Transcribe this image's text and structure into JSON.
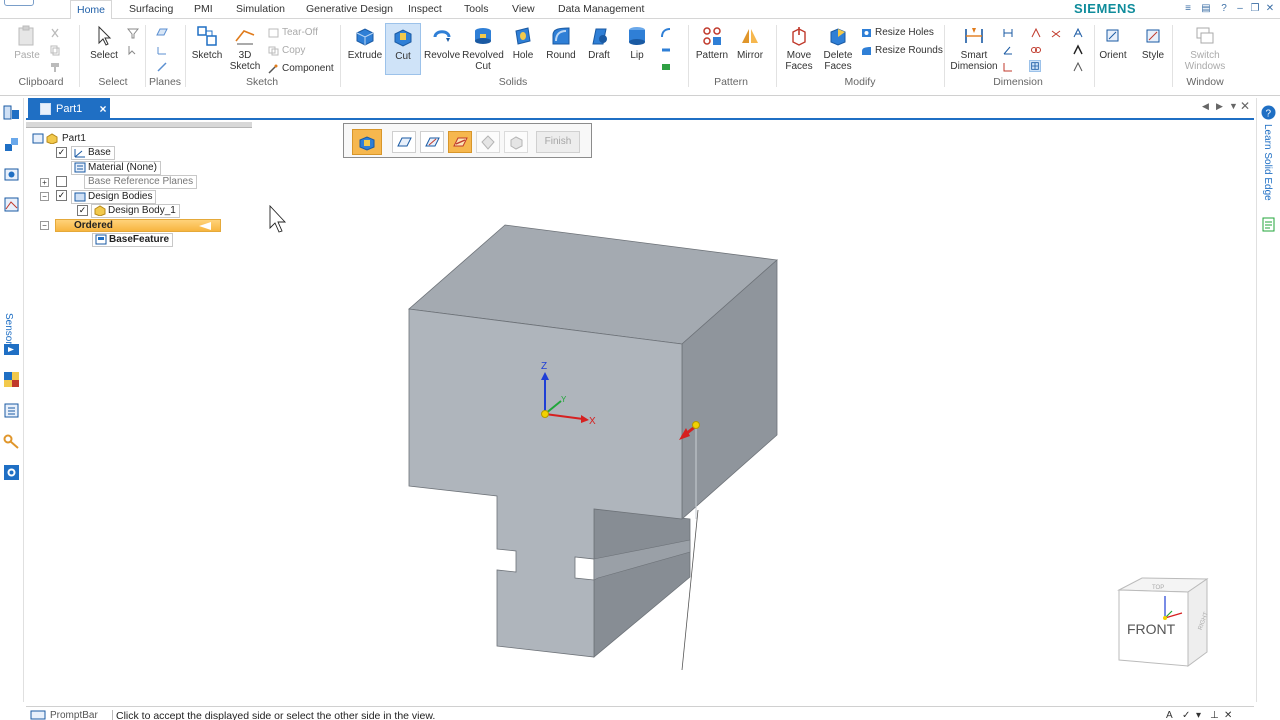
{
  "ribbon": {
    "tabs": [
      "Home",
      "Surfacing",
      "PMI",
      "Simulation",
      "Generative Design",
      "Inspect",
      "Tools",
      "View",
      "Data Management"
    ],
    "active_tab": "Home",
    "brand": "SIEMENS",
    "groups": {
      "clipboard": "Clipboard",
      "select": "Select",
      "planes": "Planes",
      "sketch": "Sketch",
      "solids": "Solids",
      "pattern": "Pattern",
      "modify": "Modify",
      "dimension": "Dimension",
      "window": "Window"
    },
    "buttons": {
      "paste": "Paste",
      "select": "Select",
      "sketch": "Sketch",
      "sketch3d_line1": "3D",
      "sketch3d_line2": "Sketch",
      "tear_off": "Tear-Off",
      "copy": "Copy",
      "component": "Component",
      "extrude": "Extrude",
      "cut": "Cut",
      "revolve": "Revolve",
      "revolved_cut_line1": "Revolved",
      "revolved_cut_line2": "Cut",
      "hole": "Hole",
      "round": "Round",
      "draft": "Draft",
      "lip": "Lip",
      "pattern": "Pattern",
      "mirror": "Mirror",
      "move_faces_line1": "Move",
      "move_faces_line2": "Faces",
      "delete_faces_line1": "Delete",
      "delete_faces_line2": "Faces",
      "resize_holes": "Resize Holes",
      "resize_rounds": "Resize Rounds",
      "smart_dimension_line1": "Smart",
      "smart_dimension_line2": "Dimension",
      "orient": "Orient",
      "style": "Style",
      "switch_windows_line1": "Switch",
      "switch_windows_line2": "Windows"
    }
  },
  "document": {
    "tab_title": "Part1"
  },
  "left_toolbar": {
    "sensors_label": "Sensors"
  },
  "pathfinder": {
    "root": "Part1",
    "base": "Base",
    "material": "Material (None)",
    "base_reference_planes": "Base Reference Planes",
    "design_bodies": "Design Bodies",
    "design_body_1": "Design Body_1",
    "ordered": "Ordered",
    "base_feature": "BaseFeature"
  },
  "command_bar": {
    "finish": "Finish"
  },
  "viewport": {
    "triad": {
      "x": "X",
      "y": "Y",
      "z": "Z"
    },
    "view_cube": {
      "front": "FRONT",
      "top": "TOP",
      "right": "RIGHT"
    }
  },
  "right_panel": {
    "learn": "Learn Solid Edge"
  },
  "prompt_bar": {
    "label": "PromptBar",
    "text": "Click to accept the displayed side or select the other side in the view."
  },
  "colors": {
    "accent": "#1f6fc4",
    "active_orange": "#f6b74e",
    "brand": "#0f8c9b",
    "model_face": "#aeb4bb",
    "model_top": "#a2a8ae",
    "model_side": "#8f959b"
  }
}
